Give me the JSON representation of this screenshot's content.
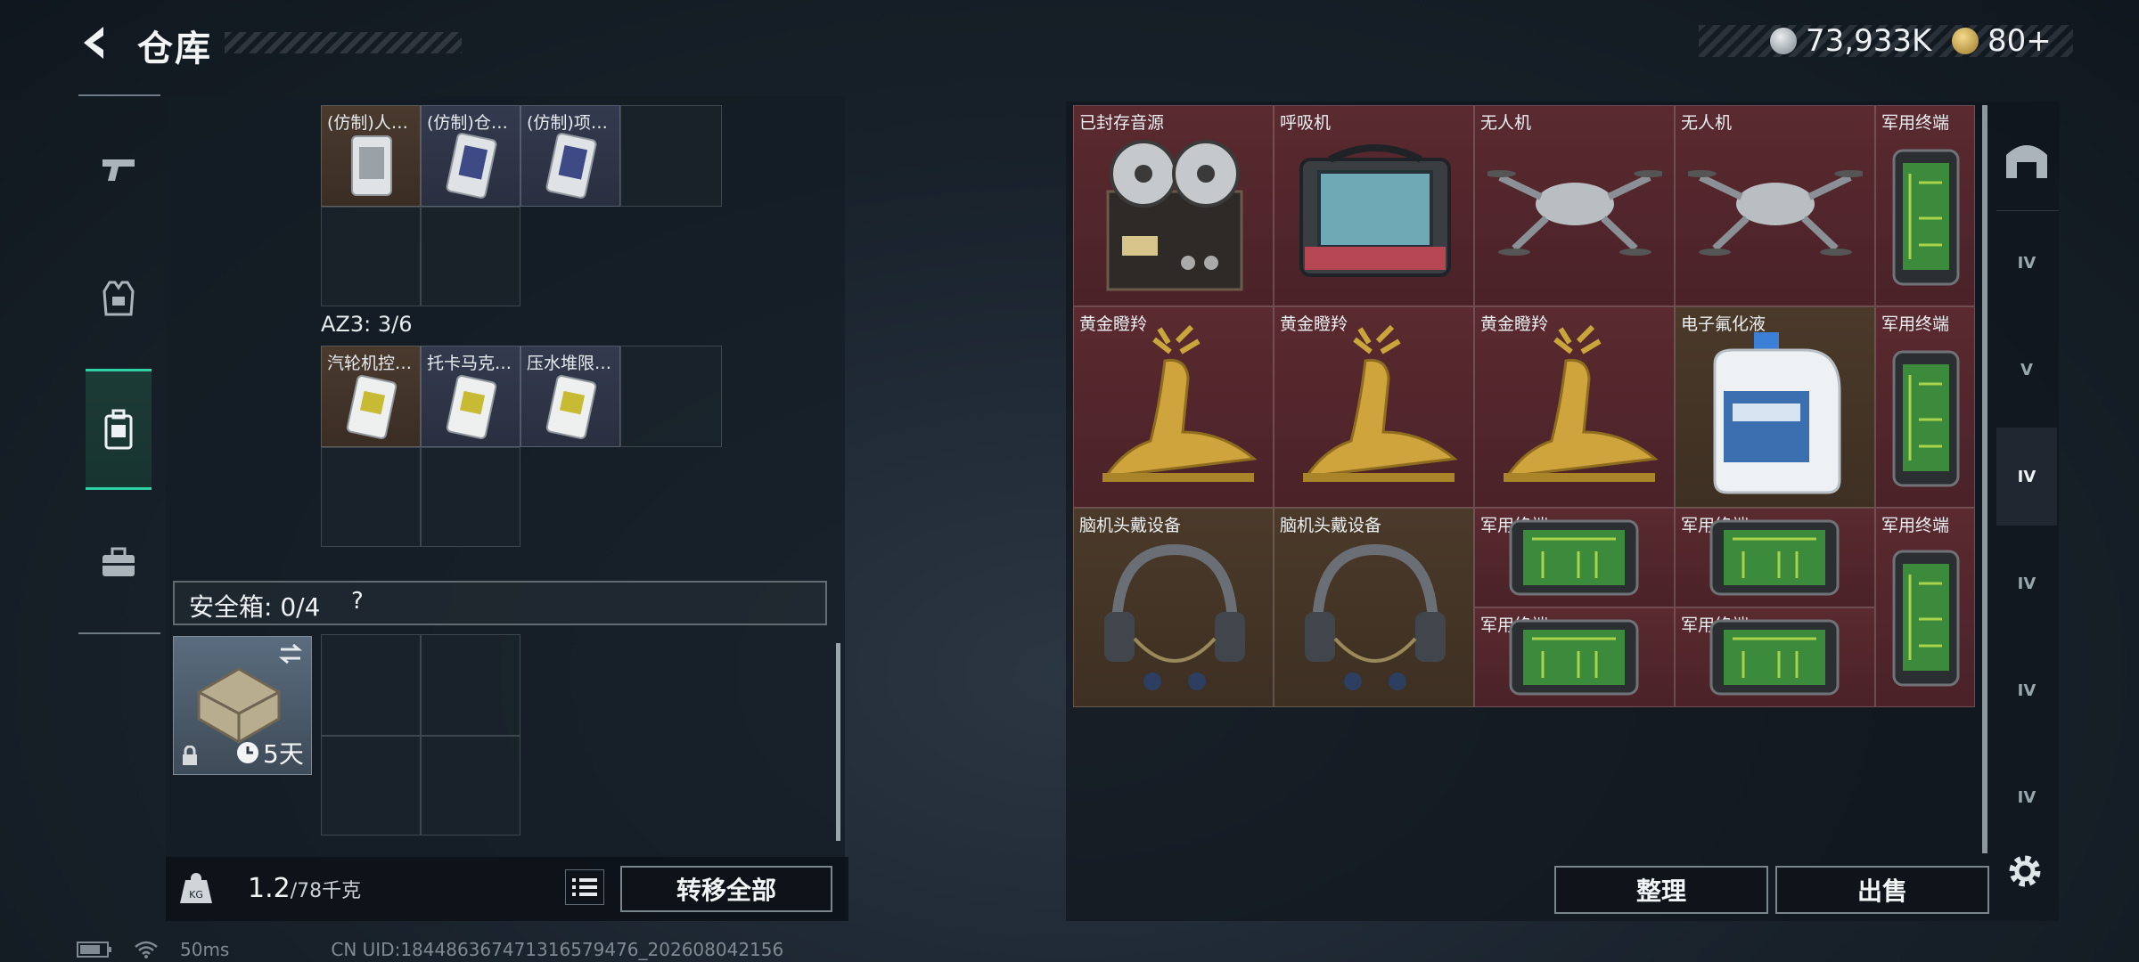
{
  "header": {
    "title": "仓库",
    "currency_silver": "73,933K",
    "currency_gold": "80+"
  },
  "nav": {
    "items": [
      "weapon-tab",
      "armor-tab",
      "backpack-tab",
      "case-tab"
    ],
    "active_index": 2
  },
  "left": {
    "container_top_items": [
      {
        "label": "(仿制)人…",
        "bg": "brown"
      },
      {
        "label": "(仿制)仓…",
        "bg": "blue"
      },
      {
        "label": "(仿制)项…",
        "bg": "blue"
      }
    ],
    "az3_label": "AZ3: 3/6",
    "az3_items": [
      {
        "label": "汽轮机控…",
        "bg": "brown"
      },
      {
        "label": "托卡马克…",
        "bg": "blue"
      },
      {
        "label": "压水堆限…",
        "bg": "blue"
      }
    ],
    "safe_box_label": "安全箱: 0/4",
    "safe_box_help": "?",
    "safe_box_timer": "5天",
    "weight_value": "1.2",
    "weight_max": "/78千克",
    "transfer_all": "转移全部"
  },
  "right": {
    "items": [
      {
        "label": "已封存音源"
      },
      {
        "label": "呼吸机"
      },
      {
        "label": "无人机"
      },
      {
        "label": "无人机"
      },
      {
        "label": "军用终端"
      },
      {
        "label": "黄金瞪羚"
      },
      {
        "label": "黄金瞪羚"
      },
      {
        "label": "黄金瞪羚"
      },
      {
        "label": "电子氟化液"
      },
      {
        "label": "军用终端"
      },
      {
        "label": "脑机头戴设备"
      },
      {
        "label": "脑机头戴设备"
      },
      {
        "label": "军用终端"
      },
      {
        "label": "军用终端"
      },
      {
        "label": "军用终端"
      },
      {
        "label": "军用终端"
      },
      {
        "label": "军用终端"
      }
    ],
    "sort_label": "整理",
    "sell_label": "出售",
    "side_tabs": [
      "home",
      "IV",
      "V",
      "IV",
      "IV",
      "IV",
      "IV"
    ]
  },
  "footer": {
    "ping": "50ms",
    "uid": "CN UID:18448636747131657947​6_202608042156"
  }
}
